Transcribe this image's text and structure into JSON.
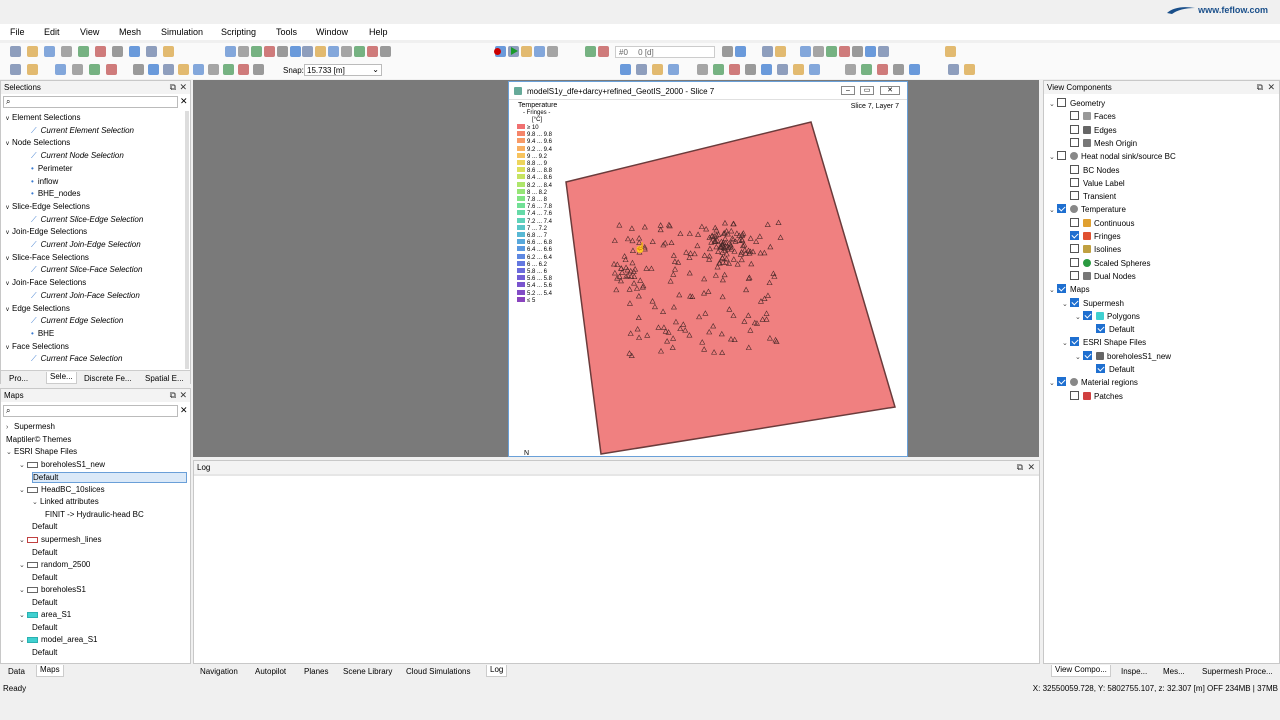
{
  "menu": [
    "File",
    "Edit",
    "View",
    "Mesh",
    "Simulation",
    "Scripting",
    "Tools",
    "Window",
    "Help"
  ],
  "brand": "www.feflow.com",
  "toolbar": {
    "time_value": "#0",
    "time_unit": "0 [d]",
    "snap_label": "Snap:",
    "snap_value": "15.733 [m]"
  },
  "selections": {
    "title": "Selections",
    "items": [
      {
        "label": "Element Selections",
        "level": 0
      },
      {
        "label": "Current Element Selection",
        "level": 1,
        "italic": true
      },
      {
        "label": "Node Selections",
        "level": 0
      },
      {
        "label": "Current Node Selection",
        "level": 1,
        "italic": true
      },
      {
        "label": "Perimeter",
        "level": 1
      },
      {
        "label": "inflow",
        "level": 1
      },
      {
        "label": "BHE_nodes",
        "level": 1
      },
      {
        "label": "Slice-Edge Selections",
        "level": 0
      },
      {
        "label": "Current Slice-Edge Selection",
        "level": 1,
        "italic": true
      },
      {
        "label": "Join-Edge Selections",
        "level": 0
      },
      {
        "label": "Current Join-Edge Selection",
        "level": 1,
        "italic": true
      },
      {
        "label": "Slice-Face Selections",
        "level": 0
      },
      {
        "label": "Current Slice-Face Selection",
        "level": 1,
        "italic": true
      },
      {
        "label": "Join-Face Selections",
        "level": 0
      },
      {
        "label": "Current Join-Face Selection",
        "level": 1,
        "italic": true
      },
      {
        "label": "Edge Selections",
        "level": 0
      },
      {
        "label": "Current Edge Selection",
        "level": 1,
        "italic": true
      },
      {
        "label": "BHE",
        "level": 1
      },
      {
        "label": "Face Selections",
        "level": 0
      },
      {
        "label": "Current Face Selection",
        "level": 1,
        "italic": true
      }
    ],
    "tabs": [
      "Pro...",
      "Sele...",
      "Discrete Fe...",
      "Spatial E..."
    ]
  },
  "maps": {
    "title": "Maps",
    "items": [
      {
        "label": "Supermesh",
        "level": 0,
        "exp": ">"
      },
      {
        "label": "Maptiler© Themes",
        "level": 0
      },
      {
        "label": "ESRI Shape Files",
        "level": 0,
        "exp": "v"
      },
      {
        "label": "boreholesS1_new",
        "level": 1,
        "exp": "v",
        "icon": "points"
      },
      {
        "label": "Default",
        "level": 2,
        "selected": true
      },
      {
        "label": "HeadBC_10slices",
        "level": 1,
        "exp": "v",
        "icon": "points"
      },
      {
        "label": "Linked attributes",
        "level": 2,
        "exp": "v"
      },
      {
        "label": "FINIT -> Hydraulic-head BC",
        "level": 3
      },
      {
        "label": "Default",
        "level": 2
      },
      {
        "label": "supermesh_lines",
        "level": 1,
        "exp": "v",
        "icon": "lines"
      },
      {
        "label": "Default",
        "level": 2
      },
      {
        "label": "random_2500",
        "level": 1,
        "exp": "v",
        "icon": "points"
      },
      {
        "label": "Default",
        "level": 2
      },
      {
        "label": "boreholesS1",
        "level": 1,
        "exp": "v",
        "icon": "points"
      },
      {
        "label": "Default",
        "level": 2
      },
      {
        "label": "area_S1",
        "level": 1,
        "exp": "v",
        "icon": "poly"
      },
      {
        "label": "Default",
        "level": 2
      },
      {
        "label": "model_area_S1",
        "level": 1,
        "exp": "v",
        "icon": "poly"
      },
      {
        "label": "Default",
        "level": 2
      }
    ],
    "tabs": [
      "Data",
      "Maps"
    ]
  },
  "view_window": {
    "title": "modelS1y_dfe+darcy+refined_GeotIS_2000 - Slice 7",
    "slice_info": "Slice 7, Layer 7",
    "north": "N",
    "legend_title": "Temperature",
    "legend_sub": "- Fringes -",
    "legend_unit": "[°C]",
    "legend": [
      {
        "label": "≥ 10",
        "color": "#f07070"
      },
      {
        "label": "9.8 ... 9.8",
        "color": "#f5856a"
      },
      {
        "label": "9.4 ... 9.6",
        "color": "#f89a66"
      },
      {
        "label": "9.2 ... 9.4",
        "color": "#f9b062"
      },
      {
        "label": "9 ... 9.2",
        "color": "#f7c35e"
      },
      {
        "label": "8.8 ... 9",
        "color": "#eed55c"
      },
      {
        "label": "8.6 ... 8.8",
        "color": "#dde05c"
      },
      {
        "label": "8.4 ... 8.6",
        "color": "#c6e462"
      },
      {
        "label": "8.2 ... 8.4",
        "color": "#aee66c"
      },
      {
        "label": "8 ... 8.2",
        "color": "#96e676"
      },
      {
        "label": "7.8 ... 8",
        "color": "#82e484"
      },
      {
        "label": "7.6 ... 7.8",
        "color": "#72e096"
      },
      {
        "label": "7.4 ... 7.6",
        "color": "#66daa8"
      },
      {
        "label": "7.2 ... 7.4",
        "color": "#5fd2ba"
      },
      {
        "label": "7 ... 7.2",
        "color": "#5ac6c8"
      },
      {
        "label": "6.8 ... 7",
        "color": "#58b8d4"
      },
      {
        "label": "6.6 ... 6.8",
        "color": "#58a8dc"
      },
      {
        "label": "6.4 ... 6.6",
        "color": "#5a98e0"
      },
      {
        "label": "6.2 ... 6.4",
        "color": "#5e88e2"
      },
      {
        "label": "6 ... 6.2",
        "color": "#6478e0"
      },
      {
        "label": "5.8 ... 6",
        "color": "#6a6adc"
      },
      {
        "label": "5.6 ... 5.8",
        "color": "#725ed6"
      },
      {
        "label": "5.4 ... 5.6",
        "color": "#7a54ce"
      },
      {
        "label": "5.2 ... 5.4",
        "color": "#824cc6"
      },
      {
        "label": "≤ 5",
        "color": "#8a44be"
      }
    ],
    "fill_color": "#f08080"
  },
  "log": {
    "title": "Log"
  },
  "bottom_tabs": [
    "Navigation",
    "Autopilot",
    "Planes",
    "Scene Library",
    "Cloud Simulations",
    "Log"
  ],
  "view_components": {
    "title": "View Components",
    "items": [
      {
        "label": "Geometry",
        "level": 0,
        "exp": "v",
        "check": false
      },
      {
        "label": "Faces",
        "level": 1,
        "check": false,
        "icon": "faces"
      },
      {
        "label": "Edges",
        "level": 1,
        "check": false,
        "icon": "edges"
      },
      {
        "label": "Mesh Origin",
        "level": 1,
        "check": false,
        "icon": "origin"
      },
      {
        "label": "Heat nodal sink/source BC",
        "level": 0,
        "exp": "v",
        "check": false,
        "icon": "gear"
      },
      {
        "label": "BC Nodes",
        "level": 1,
        "check": false
      },
      {
        "label": "Value Label",
        "level": 1,
        "check": false
      },
      {
        "label": "Transient",
        "level": 1,
        "check": false
      },
      {
        "label": "Temperature",
        "level": 0,
        "exp": "v",
        "check": true,
        "icon": "gear"
      },
      {
        "label": "Continuous",
        "level": 1,
        "check": false,
        "icon": "cont"
      },
      {
        "label": "Fringes",
        "level": 1,
        "check": true,
        "icon": "fringes"
      },
      {
        "label": "Isolines",
        "level": 1,
        "check": false,
        "icon": "iso"
      },
      {
        "label": "Scaled Spheres",
        "level": 1,
        "check": false,
        "icon": "sphere"
      },
      {
        "label": "Dual Nodes",
        "level": 1,
        "check": false,
        "icon": "dual"
      },
      {
        "label": "Maps",
        "level": 0,
        "exp": "v",
        "check": true
      },
      {
        "label": "Supermesh",
        "level": 1,
        "exp": "v",
        "check": true
      },
      {
        "label": "Polygons",
        "level": 2,
        "exp": "v",
        "check": true,
        "icon": "poly"
      },
      {
        "label": "Default",
        "level": 3,
        "check": true
      },
      {
        "label": "ESRI Shape Files",
        "level": 1,
        "exp": "v",
        "check": true
      },
      {
        "label": "boreholesS1_new",
        "level": 2,
        "exp": "v",
        "check": true,
        "icon": "points"
      },
      {
        "label": "Default",
        "level": 3,
        "check": true
      },
      {
        "label": "Material regions",
        "level": 0,
        "exp": "v",
        "check": true,
        "icon": "gear"
      },
      {
        "label": "Patches",
        "level": 1,
        "check": false,
        "icon": "patches"
      }
    ],
    "tabs": [
      "View Compo...",
      "Inspe...",
      "Mes...",
      "Supermesh Proce..."
    ]
  },
  "status": {
    "left": "Ready",
    "coords": "X: 32550059.728, Y: 5802755.107, z:  32.307 [m]  OFF   234MB | 37MB"
  }
}
